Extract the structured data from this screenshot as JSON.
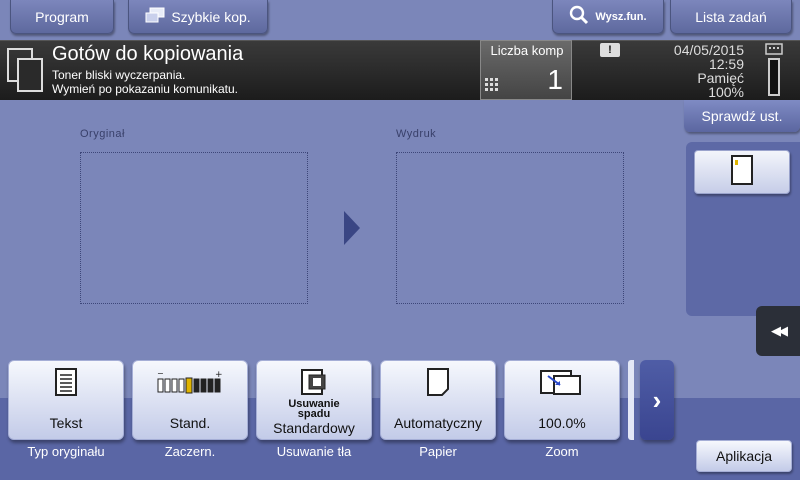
{
  "top_bar": {
    "program_label": "Program",
    "quick_copy_label": "Szybkie kop.",
    "search_label": "Wysz.fun.",
    "job_list_label": "Lista zadań"
  },
  "status": {
    "title": "Gotów do kopiowania",
    "message_line1": "Toner bliski wyczerpania.",
    "message_line2": "Wymień po pokazaniu komunikatu.",
    "copies_label": "Liczba komp",
    "copies_value": "1",
    "warning_glyph": "!",
    "date": "04/05/2015",
    "time": "12:59",
    "memory_label": "Pamięć",
    "memory_value": "100%"
  },
  "preview": {
    "original_label": "Oryginał",
    "output_label": "Wydruk"
  },
  "right": {
    "check_settings_label": "Sprawdź ust.",
    "collapse_glyph": "◀◀"
  },
  "functions": [
    {
      "value": "Tekst",
      "caption": "Typ oryginału",
      "icon": "text-document-icon"
    },
    {
      "value": "Stand.",
      "caption": "Zaczern.",
      "icon": "density-scale-icon"
    },
    {
      "value_line1": "Usuwanie",
      "value_line2": "spadu",
      "value": "Standardowy",
      "caption": "Usuwanie tła",
      "icon": "bleed-removal-icon"
    },
    {
      "value": "Automatyczny",
      "caption": "Papier",
      "icon": "paper-icon"
    },
    {
      "value": "100.0%",
      "caption": "Zoom",
      "icon": "zoom-icon"
    }
  ],
  "next_glyph": "›",
  "app_label": "Aplikacja",
  "colors": {
    "background": "#7b86b9",
    "status_bar": "#1c1c1c",
    "tray": "#5a66a5",
    "arrow": "#3a4684"
  }
}
